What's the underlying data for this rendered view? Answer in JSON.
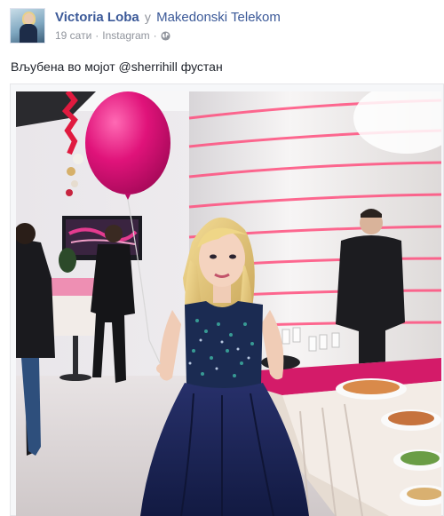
{
  "post": {
    "author": "Victoria Loba",
    "in_word": "у",
    "group": "Makedonski Telekom",
    "time": "19 сати",
    "separator": "·",
    "source": "Instagram",
    "privacy_icon": "globe-icon",
    "caption": "Вљубена во мојот @sherrihill фустан"
  },
  "colors": {
    "link": "#3b5998",
    "meta": "#90949c",
    "text": "#1d2129",
    "balloon": "#e0137a",
    "dress": "#1b2550"
  }
}
